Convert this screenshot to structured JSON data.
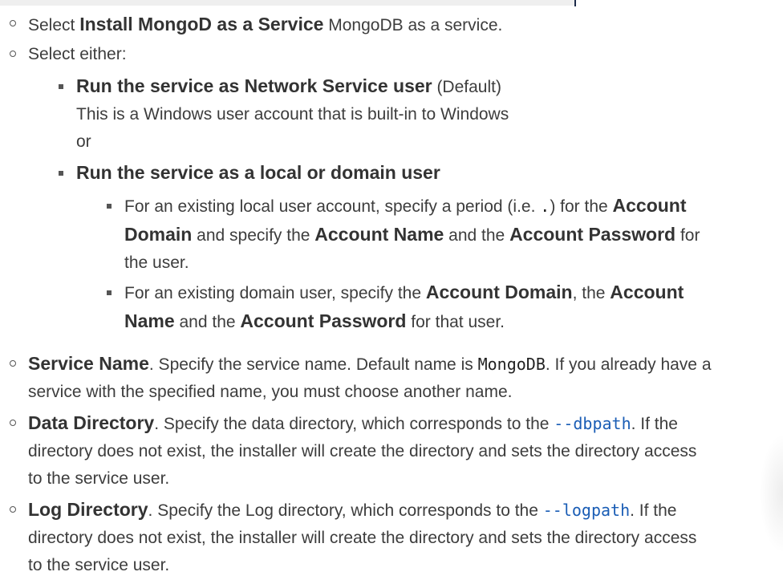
{
  "items": {
    "install_service": {
      "bold": "Install MongoD as a Service",
      "rest": " MongoDB as a service."
    },
    "select_either": {
      "text": "Select either:",
      "network_user": {
        "bold": "Run the service as Network Service user",
        "default": " (Default)",
        "desc": "This is a Windows user account that is built-in to Windows",
        "or": "or"
      },
      "local_user": {
        "bold": "Run the service as a local or domain user",
        "existing_local": {
          "t1": "For an existing local user account, specify a period (i.e. ",
          "period": ".",
          "t2": ") for the ",
          "b1": "Account",
          "b1b": "Domain",
          "t3": " and specify the ",
          "b2": "Account Name",
          "t4": " and the ",
          "b3": "Account Password",
          "t5": " for",
          "t6": "the user."
        },
        "existing_domain": {
          "t1": "For an existing domain user, specify the ",
          "b1": "Account Domain",
          "t2": ", the ",
          "b2": "Account",
          "b2b": "Name",
          "t3": " and the ",
          "b3": "Account Password",
          "t4": " for that user."
        }
      }
    },
    "select_prefix": "Select ",
    "service_name": {
      "bold": "Service Name",
      "t1": ". Specify the service name. Default name is ",
      "code": "MongoDB",
      "t2": ". If you already have a",
      "t3": "service with the specified name, you must choose another name."
    },
    "data_directory": {
      "bold": "Data Directory",
      "t1": ". Specify the data directory, which corresponds to the ",
      "code": "--dbpath",
      "t2": ". If the",
      "t3": "directory does not exist, the installer will create the directory and sets the directory access",
      "t4": "to the service user."
    },
    "log_directory": {
      "bold": "Log Directory",
      "t1": ". Specify the Log directory, which corresponds to the ",
      "code": "--logpath",
      "t2": ". If the",
      "t3": "directory does not exist, the installer will create the directory and sets the directory access",
      "t4": "to the service user."
    }
  }
}
